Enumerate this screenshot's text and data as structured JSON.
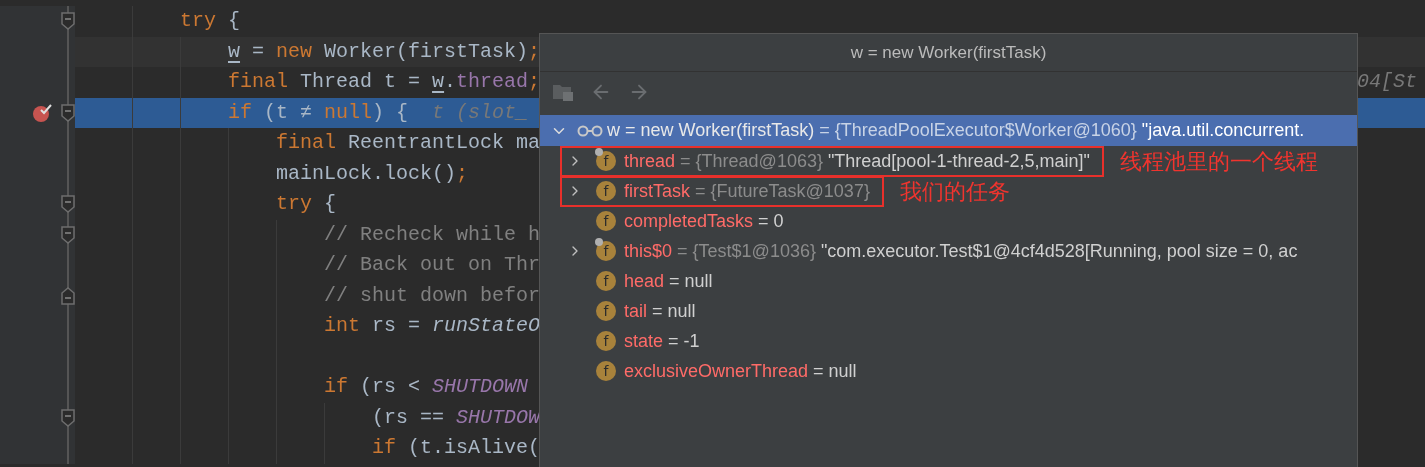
{
  "editor": {
    "lines": [
      {
        "kind": "code",
        "fold_start": true,
        "tokens": [
          {
            "kind": "kw",
            "text": "try"
          },
          {
            "kind": "plain",
            "text": " {"
          }
        ],
        "children": [
          {
            "kind": "code",
            "caret_line": true,
            "tokens": [
              {
                "kind": "var",
                "text": "w"
              },
              {
                "kind": "plain",
                "text": " = "
              },
              {
                "kind": "kw",
                "text": "new"
              },
              {
                "kind": "plain",
                "text": " Worker(firstTask)"
              },
              {
                "kind": "kw",
                "text": ";"
              }
            ]
          },
          {
            "kind": "code",
            "tokens": [
              {
                "kind": "kw",
                "text": "final"
              },
              {
                "kind": "plain",
                "text": " Thread t = "
              },
              {
                "kind": "var",
                "text": "w"
              },
              {
                "kind": "plain",
                "text": "."
              },
              {
                "kind": "field",
                "text": "thread"
              },
              {
                "kind": "kw",
                "text": ";"
              }
            ],
            "tail": "04[St"
          },
          {
            "kind": "code",
            "fold_start": true,
            "breakpoint": true,
            "execution_point": true,
            "tokens": [
              {
                "kind": "kw",
                "text": "if"
              },
              {
                "kind": "plain",
                "text": " (t ≠ "
              },
              {
                "kind": "kw",
                "text": "null"
              },
              {
                "kind": "plain",
                "text": ") {  "
              },
              {
                "kind": "hint",
                "text": "t (slot_"
              }
            ],
            "children": [
              {
                "kind": "code",
                "tokens": [
                  {
                    "kind": "kw",
                    "text": "final"
                  },
                  {
                    "kind": "plain",
                    "text": " ReentrantLock ma"
                  }
                ]
              },
              {
                "kind": "code",
                "tokens": [
                  {
                    "kind": "plain",
                    "text": "mainLock.lock()"
                  },
                  {
                    "kind": "kw",
                    "text": ";"
                  }
                ]
              },
              {
                "kind": "code",
                "fold_start": true,
                "tokens": [
                  {
                    "kind": "kw",
                    "text": "try"
                  },
                  {
                    "kind": "plain",
                    "text": " {"
                  }
                ],
                "children": [
                  {
                    "kind": "code",
                    "fold_start": true,
                    "tokens": [
                      {
                        "kind": "comment",
                        "text": "// Recheck while h"
                      }
                    ]
                  },
                  {
                    "kind": "code",
                    "tokens": [
                      {
                        "kind": "comment",
                        "text": "// Back out on Thr"
                      }
                    ]
                  },
                  {
                    "kind": "code",
                    "fold_end": true,
                    "tokens": [
                      {
                        "kind": "comment",
                        "text": "// shut down befor"
                      }
                    ]
                  },
                  {
                    "kind": "code",
                    "tokens": [
                      {
                        "kind": "kw",
                        "text": "int"
                      },
                      {
                        "kind": "plain",
                        "text": " rs = "
                      },
                      {
                        "kind": "method",
                        "text": "runStateO"
                      }
                    ]
                  },
                  {
                    "kind": "blank"
                  },
                  {
                    "kind": "code",
                    "tokens": [
                      {
                        "kind": "kw",
                        "text": "if"
                      },
                      {
                        "kind": "plain",
                        "text": " (rs < "
                      },
                      {
                        "kind": "const",
                        "text": "SHUTDOWN"
                      }
                    ],
                    "children": [
                      {
                        "kind": "code",
                        "fold_start": true,
                        "tokens": [
                          {
                            "kind": "plain",
                            "text": "(rs == "
                          },
                          {
                            "kind": "const",
                            "text": "SHUTDOW"
                          }
                        ]
                      },
                      {
                        "kind": "code",
                        "tokens": [
                          {
                            "kind": "kw",
                            "text": "if"
                          },
                          {
                            "kind": "plain",
                            "text": " (t.isAlive("
                          }
                        ]
                      }
                    ]
                  }
                ]
              }
            ]
          }
        ]
      }
    ]
  },
  "popup": {
    "title": "w = new Worker(firstTask)",
    "root": {
      "name": "w = new Worker(firstTask)",
      "ref": "= {ThreadPoolExecutor$Worker@1060}",
      "value": "\"java.util.concurrent.",
      "expanded": true,
      "selected": true,
      "children": [
        {
          "badge": "f",
          "marked": true,
          "expanded": false,
          "name": "thread",
          "ref": "= {Thread@1063}",
          "value": "\"Thread[pool-1-thread-2,5,main]\"",
          "annotation": "线程池里的一个线程"
        },
        {
          "badge": "f",
          "marked": false,
          "expanded": false,
          "name": "firstTask",
          "ref": "= {FutureTask@1037}",
          "annotation": "我们的任务"
        },
        {
          "badge": "f",
          "marked": false,
          "name": "completedTasks",
          "value": "= 0"
        },
        {
          "badge": "f",
          "marked": true,
          "expanded": false,
          "name": "this$0",
          "ref": "= {Test$1@1036}",
          "value": "\"com.executor.Test$1@4cf4d528[Running, pool size = 0, ac"
        },
        {
          "badge": "f",
          "marked": false,
          "name": "head",
          "value": "= null"
        },
        {
          "badge": "f",
          "marked": false,
          "name": "tail",
          "value": "= null"
        },
        {
          "badge": "f",
          "marked": false,
          "name": "state",
          "value": "= -1"
        },
        {
          "badge": "f",
          "marked": false,
          "name": "exclusiveOwnerThread",
          "value": "= null"
        }
      ]
    }
  }
}
